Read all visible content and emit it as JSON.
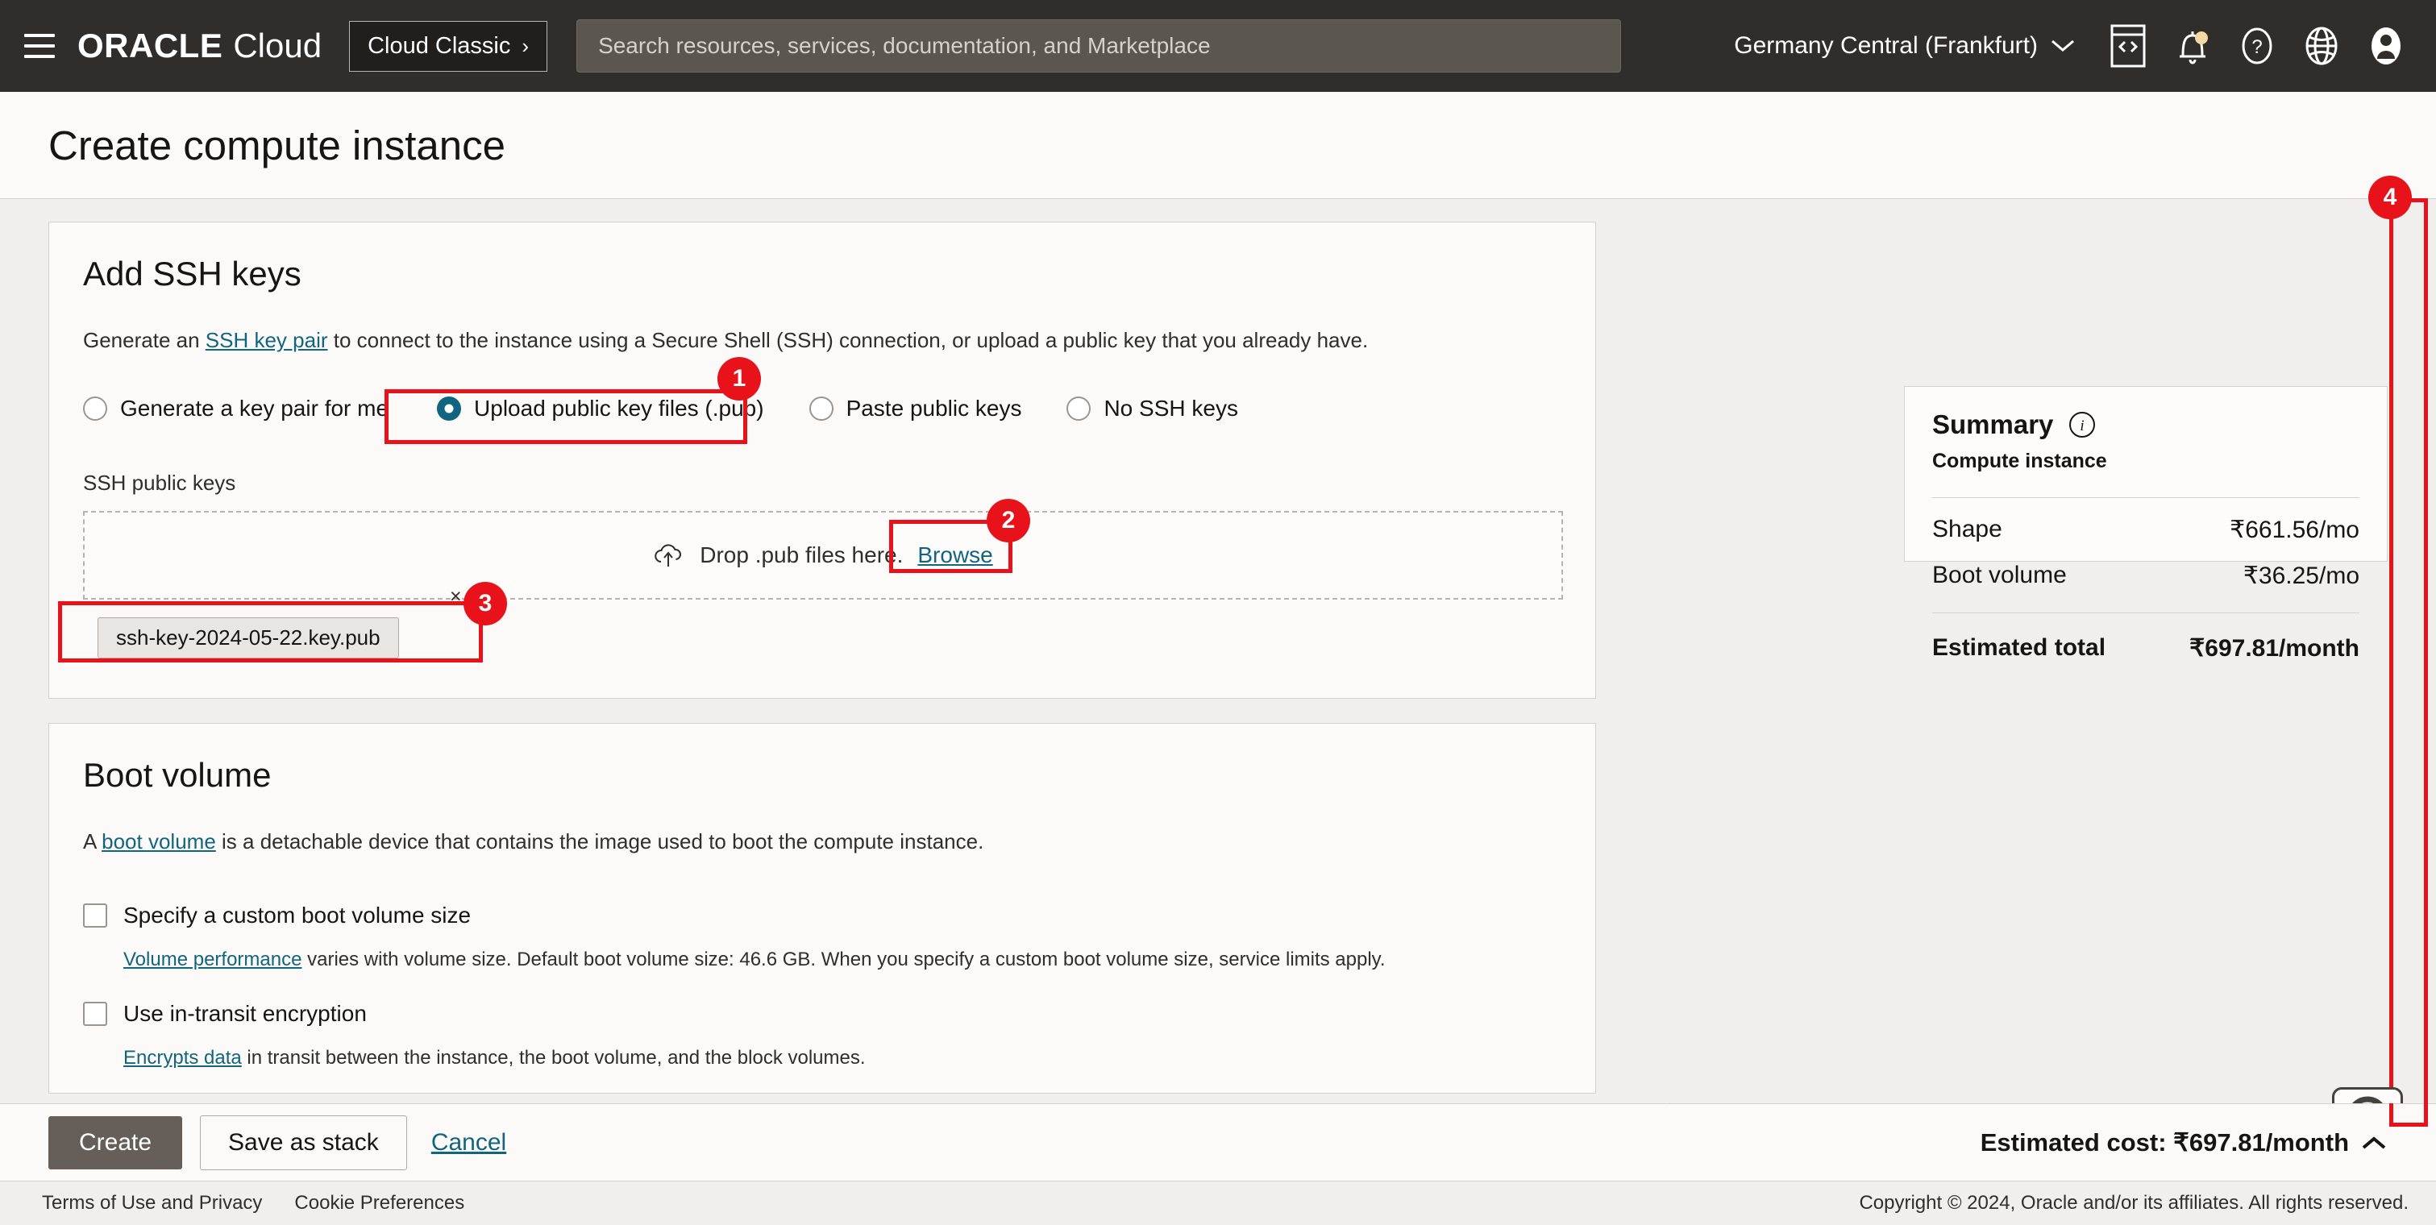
{
  "topnav": {
    "menu_icon": "hamburger-menu-icon",
    "brand_primary": "ORACLE",
    "brand_secondary": "Cloud",
    "cloud_classic_label": "Cloud Classic",
    "cloud_classic_chevron": "›",
    "search_placeholder": "Search resources, services, documentation, and Marketplace",
    "search_value": "",
    "region_label": "Germany Central (Frankfurt)",
    "region_chevron": "∨",
    "icons": [
      {
        "name": "cloud-shell-icon"
      },
      {
        "name": "notifications-bell-icon"
      },
      {
        "name": "help-question-icon"
      },
      {
        "name": "language-globe-icon"
      },
      {
        "name": "user-avatar-icon"
      }
    ]
  },
  "page": {
    "title": "Create compute instance"
  },
  "ssh": {
    "heading": "Add SSH keys",
    "desc_before": "Generate an ",
    "desc_link": "SSH key pair",
    "desc_after": " to connect to the instance using a Secure Shell (SSH) connection, or upload a public key that you already have.",
    "options": [
      {
        "label": "Generate a key pair for me",
        "selected": false
      },
      {
        "label": "Upload public key files (.pub)",
        "selected": true
      },
      {
        "label": "Paste public keys",
        "selected": false
      },
      {
        "label": "No SSH keys",
        "selected": false
      }
    ],
    "field_label": "SSH public keys",
    "dropzone_text": "Drop .pub files here.",
    "dropzone_link": "Browse",
    "dropzone_icon": "cloud-upload-icon",
    "file_chip": "ssh-key-2024-05-22.key.pub",
    "file_chip_remove": "×"
  },
  "boot": {
    "heading": "Boot volume",
    "desc_before": "A ",
    "desc_link": "boot volume",
    "desc_after": " is a detachable device that contains the image used to boot the compute instance.",
    "checkbox_custom_size": {
      "label": "Specify a custom boot volume size",
      "checked": false,
      "help_link": "Volume performance",
      "help_text": " varies with volume size. Default boot volume size: 46.6 GB. When you specify a custom boot volume size, service limits apply."
    },
    "checkbox_in_transit": {
      "label": "Use in-transit encryption",
      "checked": false,
      "help_link": "Encrypts data",
      "help_text": " in transit between the instance, the boot volume, and the block volumes."
    }
  },
  "summary": {
    "title": "Summary",
    "info_icon": "info-circle-icon",
    "subtitle": "Compute instance",
    "rows": [
      {
        "label": "Shape",
        "value": "₹661.56/mo"
      },
      {
        "label": "Boot volume",
        "value": "₹36.25/mo"
      }
    ],
    "total_label": "Estimated total",
    "total_value": "₹697.81/month"
  },
  "help_widget": {
    "icon": "life-ring-icon",
    "grid_icon": "grid-dots-icon"
  },
  "actionbar": {
    "create_label": "Create",
    "save_stack_label": "Save as stack",
    "cancel_label": "Cancel",
    "estimated_cost": "Estimated cost: ₹697.81/month",
    "collapse_chevron": "∧"
  },
  "footer": {
    "terms": "Terms of Use and Privacy",
    "cookies": "Cookie Preferences",
    "copyright": "Copyright © 2024, Oracle and/or its affiliates. All rights reserved."
  },
  "annotations": {
    "color": "#e8131a",
    "markers": [
      {
        "id": "1",
        "target": "upload-public-key-files-radio"
      },
      {
        "id": "2",
        "target": "browse-link"
      },
      {
        "id": "3",
        "target": "ssh-key-file-chip"
      },
      {
        "id": "4",
        "target": "page-scrollbar"
      }
    ]
  }
}
